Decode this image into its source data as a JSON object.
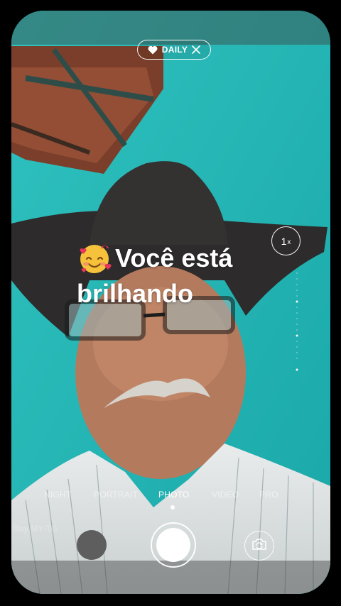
{
  "badge": {
    "icon": "heart-icon",
    "label": "DAILY",
    "close_icon": "close-icon"
  },
  "zoom": {
    "value": "1",
    "suffix": "x"
  },
  "caption": {
    "emoji": "smiling-face-with-hearts",
    "line1": "Você está",
    "line2": "brilhando"
  },
  "modes": [
    {
      "label": "NIGHT"
    },
    {
      "label": "PORTRAIT"
    },
    {
      "label": "PHOTO"
    },
    {
      "label": "VIDEO"
    },
    {
      "label": "PRO"
    }
  ],
  "active_mode": "PHOTO",
  "watermark": "Ray MY-TG",
  "controls": {
    "gallery": "gallery-thumbnail",
    "shutter": "shutter-button",
    "flip": "flip-camera-icon"
  }
}
